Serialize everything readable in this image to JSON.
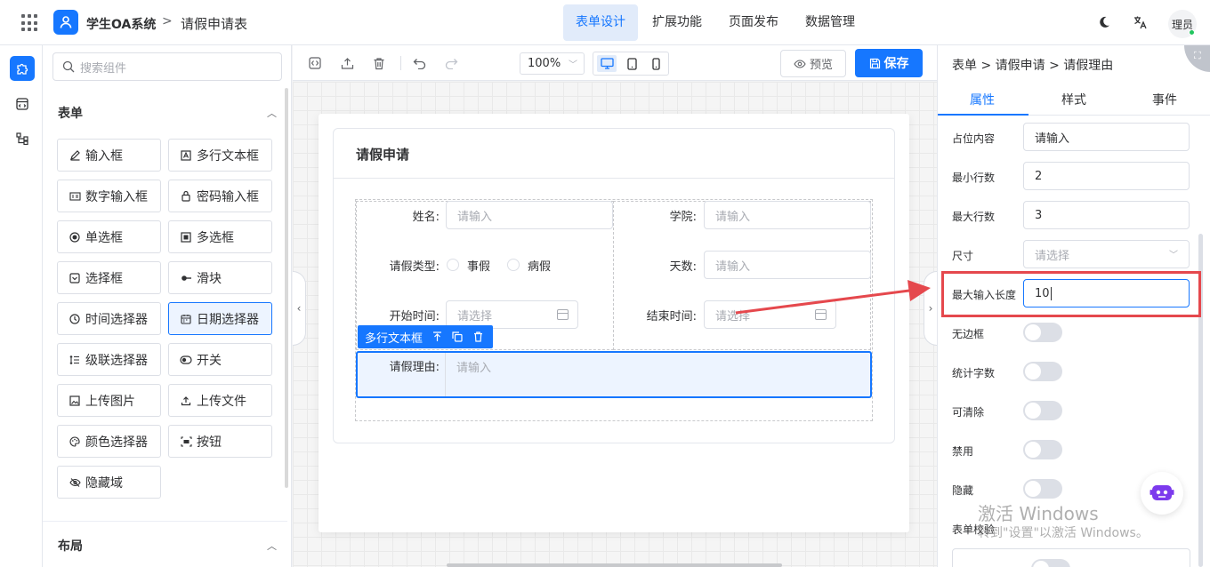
{
  "header": {
    "app_name": "学生OA系统",
    "separator": ">",
    "page": "请假申请表",
    "nav": [
      {
        "label": "表单设计",
        "active": true
      },
      {
        "label": "扩展功能",
        "active": false
      },
      {
        "label": "页面发布",
        "active": false
      },
      {
        "label": "数据管理",
        "active": false
      }
    ],
    "avatar_text": "理员"
  },
  "components": {
    "search_placeholder": "搜索组件",
    "section_form": "表单",
    "section_layout": "布局",
    "items": [
      {
        "label": "输入框",
        "icon": "pencil-icon"
      },
      {
        "label": "多行文本框",
        "icon": "textarea-icon"
      },
      {
        "label": "数字输入框",
        "icon": "number-icon"
      },
      {
        "label": "密码输入框",
        "icon": "lock-icon"
      },
      {
        "label": "单选框",
        "icon": "radio-icon"
      },
      {
        "label": "多选框",
        "icon": "checkbox-icon"
      },
      {
        "label": "选择框",
        "icon": "select-icon"
      },
      {
        "label": "滑块",
        "icon": "slider-icon"
      },
      {
        "label": "时间选择器",
        "icon": "clock-icon"
      },
      {
        "label": "日期选择器",
        "icon": "calendar-icon",
        "active": true
      },
      {
        "label": "级联选择器",
        "icon": "cascader-icon"
      },
      {
        "label": "开关",
        "icon": "toggle-icon"
      },
      {
        "label": "上传图片",
        "icon": "image-icon"
      },
      {
        "label": "上传文件",
        "icon": "upload-icon"
      },
      {
        "label": "颜色选择器",
        "icon": "palette-icon"
      },
      {
        "label": "按钮",
        "icon": "button-icon"
      },
      {
        "label": "隐藏域",
        "icon": "eye-off-icon"
      }
    ]
  },
  "toolbar": {
    "zoom": "100%",
    "preview_label": "预览",
    "save_label": "保存"
  },
  "form": {
    "title": "请假申请",
    "fields": {
      "name_label": "姓名:",
      "name_placeholder": "请输入",
      "college_label": "学院:",
      "college_placeholder": "请输入",
      "leave_type_label": "请假类型:",
      "leave_type_options": [
        "事假",
        "病假"
      ],
      "days_label": "天数:",
      "days_placeholder": "请输入",
      "start_label": "开始时间:",
      "start_placeholder": "请选择",
      "end_label": "结束时间:",
      "end_placeholder": "请选择",
      "reason_label": "请假理由:",
      "reason_placeholder": "请输入"
    },
    "selected_tag": "多行文本框"
  },
  "props": {
    "breadcrumb": "表单 > 请假申请 > 请假理由",
    "tabs": [
      {
        "label": "属性",
        "active": true
      },
      {
        "label": "样式",
        "active": false
      },
      {
        "label": "事件",
        "active": false
      }
    ],
    "placeholder_label": "占位内容",
    "placeholder_value": "请输入",
    "min_rows_label": "最小行数",
    "min_rows_value": "2",
    "max_rows_label": "最大行数",
    "max_rows_value": "3",
    "size_label": "尺寸",
    "size_placeholder": "请选择",
    "maxlength_label": "最大输入长度",
    "maxlength_value": "10",
    "switches": [
      {
        "label": "无边框",
        "on": false
      },
      {
        "label": "统计字数",
        "on": false
      },
      {
        "label": "可清除",
        "on": false
      },
      {
        "label": "禁用",
        "on": false
      },
      {
        "label": "隐藏",
        "on": false
      }
    ],
    "validation_label": "表单校验"
  },
  "watermark": {
    "line1": "激活 Windows",
    "line2": "转到\"设置\"以激活 Windows。"
  },
  "colors": {
    "primary": "#1677ff",
    "annotation": "#e5484d"
  }
}
